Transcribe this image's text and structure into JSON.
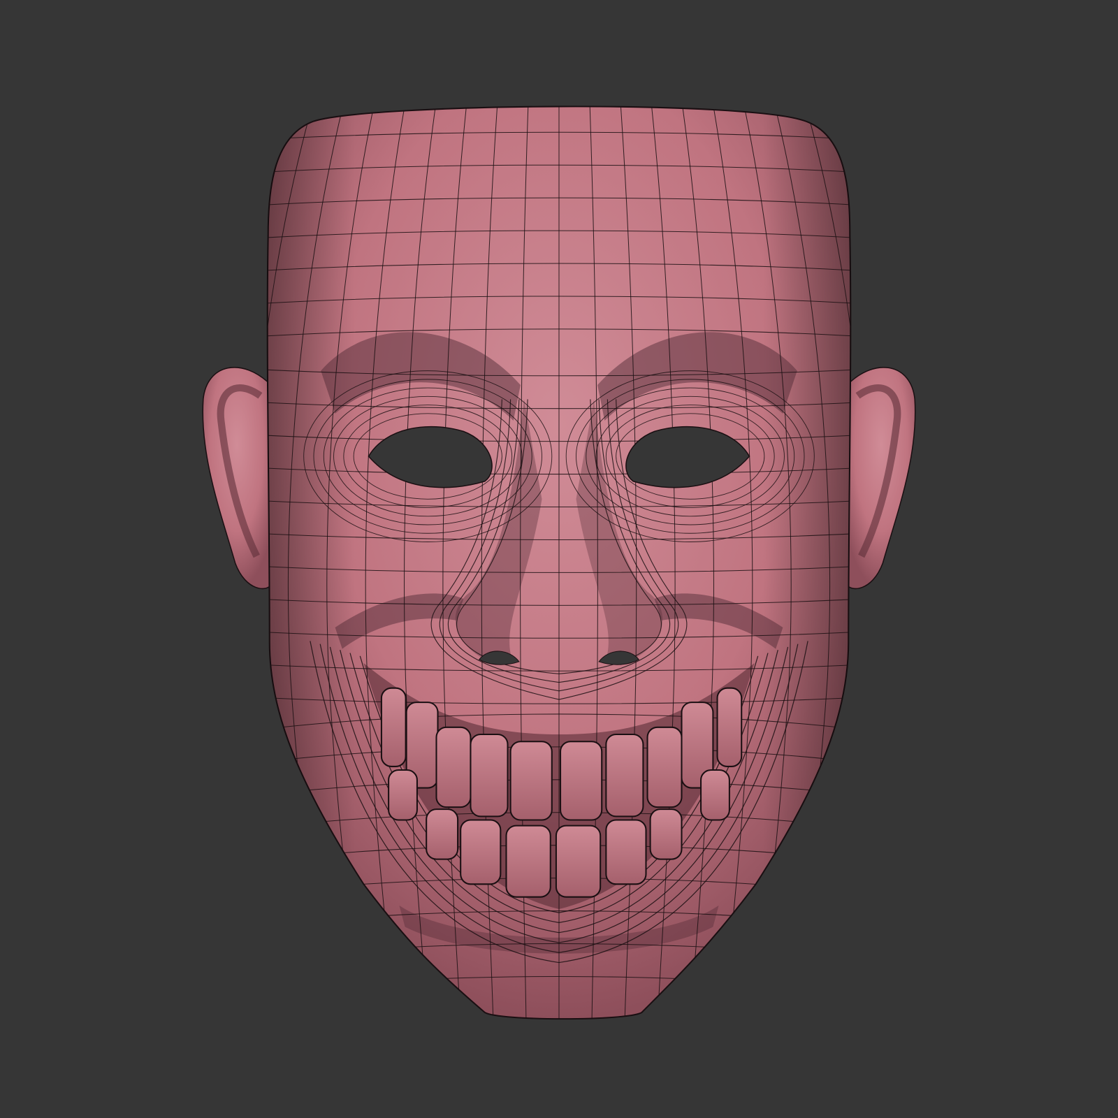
{
  "scene": {
    "background_color": "#363636",
    "mask_color": "#c27884",
    "mask_shadow_color": "#6e3a45",
    "wire_color": "#1a0f12",
    "hole_color": "#363636"
  }
}
